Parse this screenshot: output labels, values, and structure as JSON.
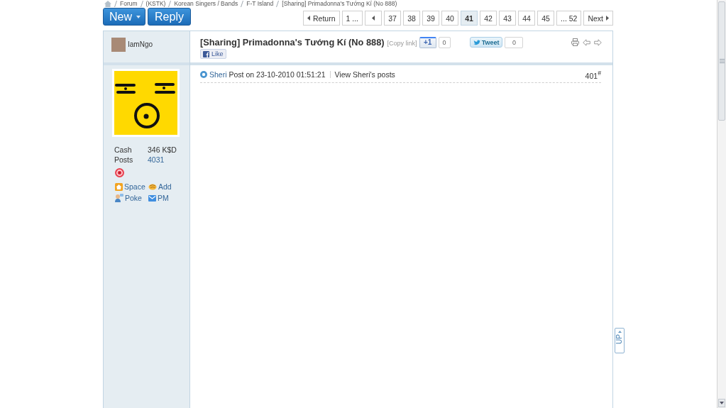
{
  "breadcrumb": [
    "Forum",
    "(KSTK)",
    "Korean Singers / Bands",
    "F-T Island",
    "[Sharing] Primadonna's Tướng Kí (No 888)"
  ],
  "toolbar": [
    {
      "label": "New",
      "kind": "dropdown"
    },
    {
      "label": "Reply",
      "kind": "plain"
    }
  ],
  "pagination": [
    {
      "label": "Return",
      "kind": "back",
      "selected": false
    },
    {
      "label": "1 ...",
      "kind": "page",
      "selected": false
    },
    {
      "kind": "prev",
      "selected": false
    },
    {
      "label": "37",
      "kind": "page",
      "selected": false
    },
    {
      "label": "38",
      "kind": "page",
      "selected": false
    },
    {
      "label": "39",
      "kind": "page",
      "selected": false
    },
    {
      "label": "40",
      "kind": "page",
      "selected": false
    },
    {
      "label": "41",
      "kind": "page",
      "selected": true
    },
    {
      "label": "42",
      "kind": "page",
      "selected": false
    },
    {
      "label": "43",
      "kind": "page",
      "selected": false
    },
    {
      "label": "44",
      "kind": "page",
      "selected": false
    },
    {
      "label": "45",
      "kind": "page",
      "selected": false
    },
    {
      "label": "... 52",
      "kind": "page",
      "selected": false
    },
    {
      "label": "Next",
      "kind": "next",
      "selected": false
    }
  ],
  "thread": {
    "author": "IamNgo",
    "title": "[Sharing] Primadonna's Tướng Kí (No 888)",
    "copy_link": "[Copy link]",
    "plus_one": {
      "label": "+1",
      "count": "0"
    },
    "tweet": {
      "label": "Tweet",
      "count": "0"
    },
    "like": "Like"
  },
  "profile": {
    "stats": [
      {
        "label": "Cash",
        "value": "346 K$D",
        "kind": "text"
      },
      {
        "label": "Posts",
        "value": "4031",
        "kind": "link"
      }
    ],
    "links": [
      {
        "label": "Space",
        "kind": "home"
      },
      {
        "label": "Add",
        "kind": "friend"
      },
      {
        "label": "Poke",
        "kind": "poke"
      },
      {
        "label": "PM",
        "kind": "mail"
      }
    ]
  },
  "post": {
    "author": "Sheri",
    "posted": "Post on 23-10-2010 01:51:21",
    "view_posts": "View Sheri's posts",
    "floor": "401$^{#}$"
  },
  "back_to_top": "UP"
}
